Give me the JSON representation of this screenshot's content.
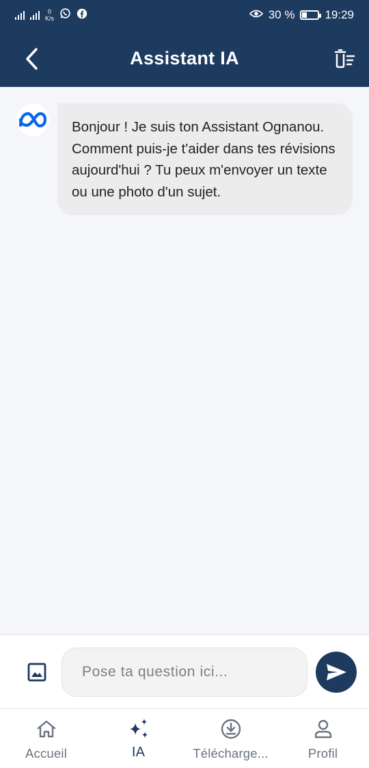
{
  "status_bar": {
    "network_speed_value": "0",
    "network_speed_unit": "K/s",
    "battery_percent": "30 %",
    "time": "19:29",
    "battery_level": 0.3
  },
  "header": {
    "title": "Assistant IA"
  },
  "chat": {
    "messages": [
      {
        "sender": "assistant",
        "text": "Bonjour ! Je suis ton Assistant Ognanou. Comment puis-je t'aider dans tes révisions aujourd'hui ? Tu peux m'envoyer un texte ou une photo d'un sujet."
      }
    ]
  },
  "composer": {
    "placeholder": "Pose ta question ici...",
    "value": ""
  },
  "nav": {
    "items": [
      {
        "label": "Accueil",
        "icon": "home-icon",
        "active": false
      },
      {
        "label": "IA",
        "icon": "sparkles-icon",
        "active": true
      },
      {
        "label": "Télécharge...",
        "icon": "download-icon",
        "active": false
      },
      {
        "label": "Profil",
        "icon": "person-icon",
        "active": false
      }
    ]
  },
  "colors": {
    "primary": "#1d3a5f",
    "background": "#f4f6f9",
    "bubble": "#ececec",
    "meta_blue": "#0a66e6",
    "nav_inactive": "#6b7380"
  }
}
